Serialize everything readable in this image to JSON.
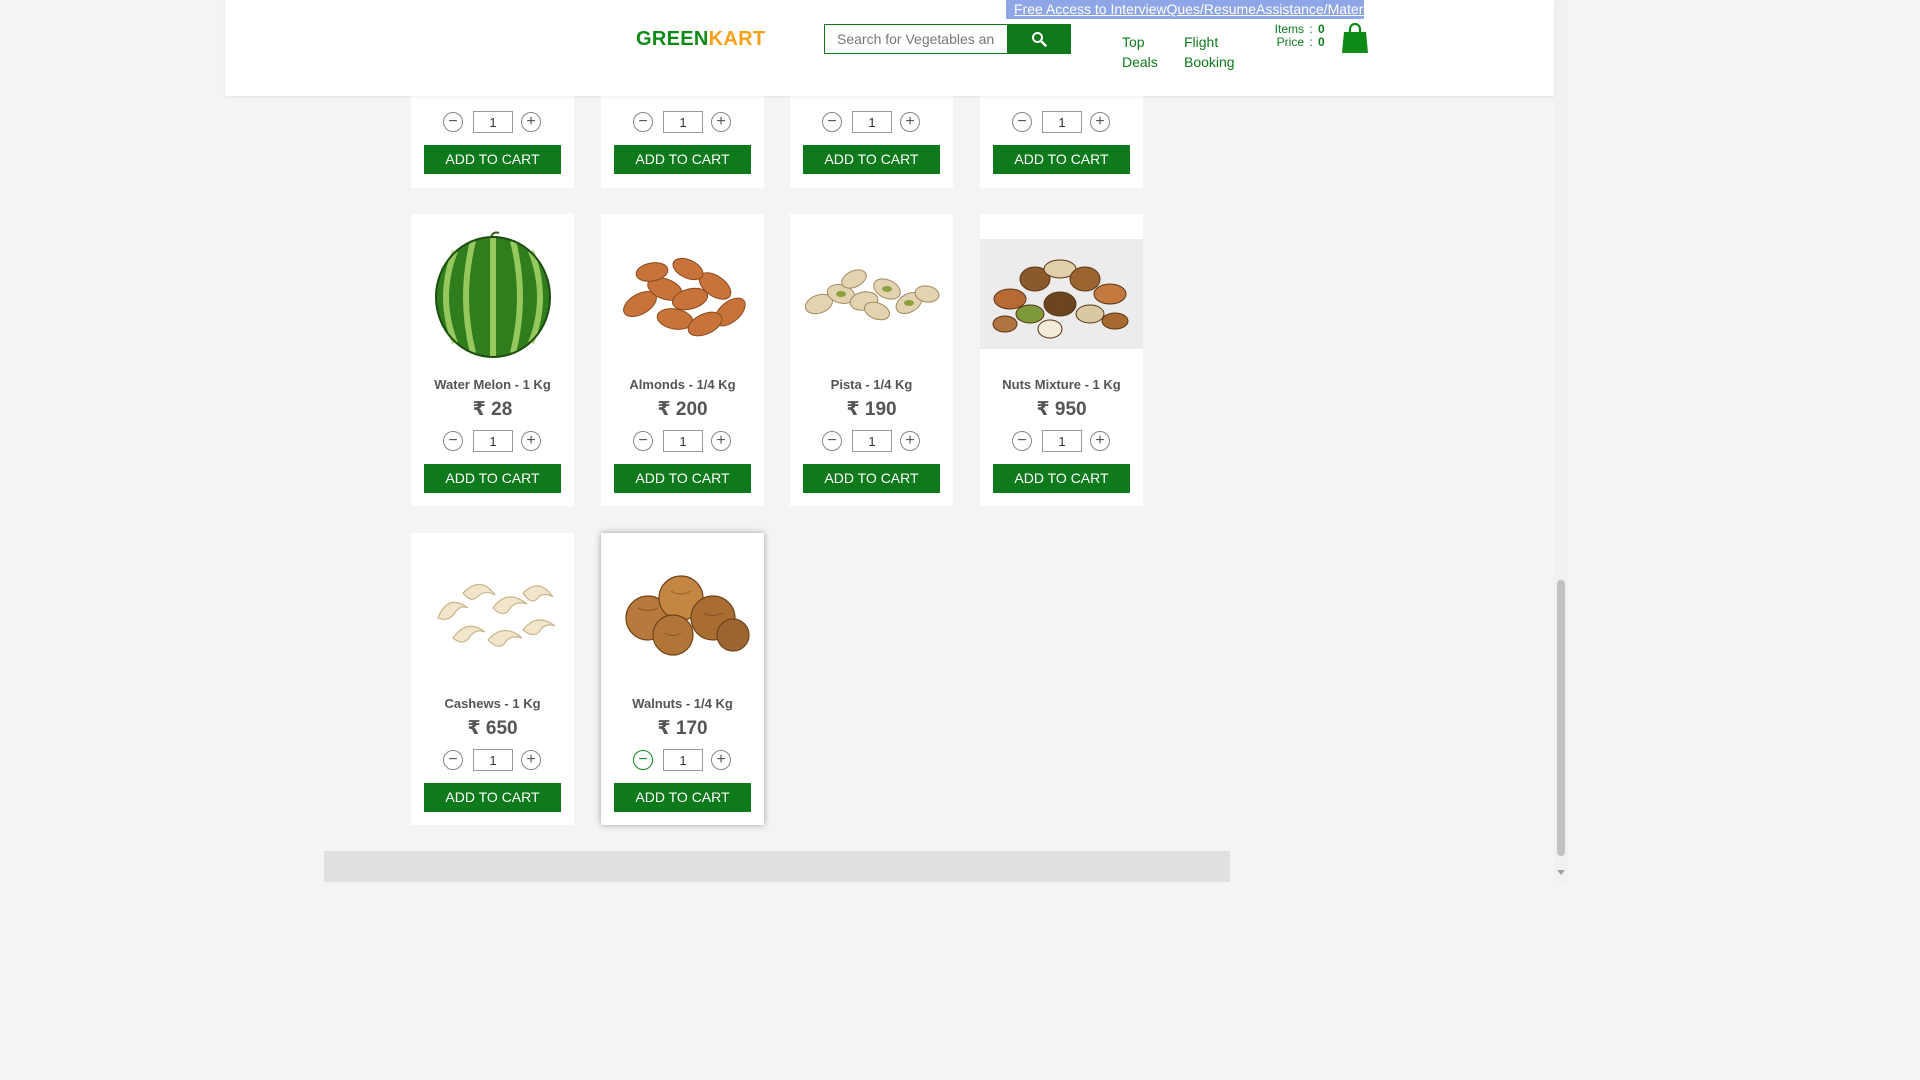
{
  "header": {
    "banner_text": "Free Access to InterviewQues/ResumeAssistance/Material",
    "logo_part1": "GREEN",
    "logo_part2": "KART",
    "search_placeholder": "Search for Vegetables and Fruits",
    "nav": {
      "top_deals_line1": "Top",
      "top_deals_line2": "Deals",
      "flight_booking_line1": "Flight",
      "flight_booking_line2": "Booking"
    },
    "cart": {
      "items_label": "Items",
      "items_value": "0",
      "price_label": "Price",
      "price_value": "0",
      "separator": ":"
    }
  },
  "top_row_partial": [
    {
      "qty": "1",
      "add_label": "ADD TO CART"
    },
    {
      "qty": "1",
      "add_label": "ADD TO CART"
    },
    {
      "qty": "1",
      "add_label": "ADD TO CART"
    },
    {
      "qty": "1",
      "add_label": "ADD TO CART"
    }
  ],
  "products": [
    {
      "name": "Water Melon - 1 Kg",
      "price": "₹ 28",
      "qty": "1",
      "add_label": "ADD TO CART",
      "image": "watermelon"
    },
    {
      "name": "Almonds - 1/4 Kg",
      "price": "₹ 200",
      "qty": "1",
      "add_label": "ADD TO CART",
      "image": "almonds"
    },
    {
      "name": "Pista - 1/4 Kg",
      "price": "₹ 190",
      "qty": "1",
      "add_label": "ADD TO CART",
      "image": "pistachios"
    },
    {
      "name": "Nuts Mixture - 1 Kg",
      "price": "₹ 950",
      "qty": "1",
      "add_label": "ADD TO CART",
      "image": "nuts-mixture"
    },
    {
      "name": "Cashews - 1 Kg",
      "price": "₹ 650",
      "qty": "1",
      "add_label": "ADD TO CART",
      "image": "cashews"
    },
    {
      "name": "Walnuts - 1/4 Kg",
      "price": "₹ 170",
      "qty": "1",
      "add_label": "ADD TO CART",
      "image": "walnuts"
    }
  ],
  "colors": {
    "brand_green": "#0e7a1c",
    "logo_orange": "#f7a11a",
    "banner_blue": "#8fa6e6"
  }
}
